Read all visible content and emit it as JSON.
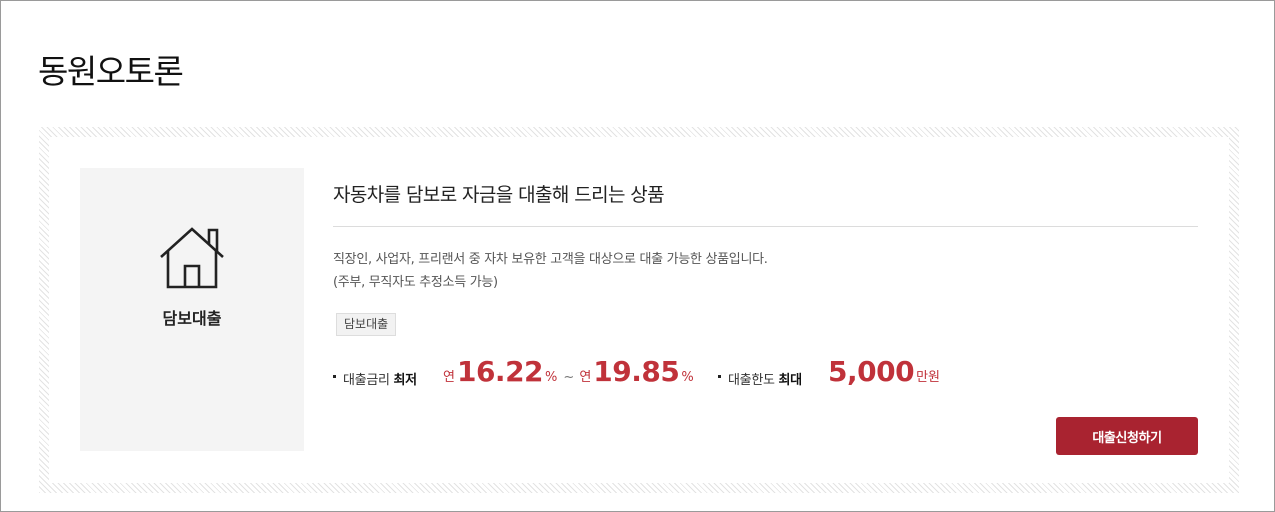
{
  "page": {
    "title": "동원오토론"
  },
  "product": {
    "thumb_label": "담보대출",
    "thumb_icon": "house-icon",
    "headline": "자동차를 담보로 자금을 대출해 드리는 상품",
    "description_line1": "직장인, 사업자, 프리랜서 중 자차 보유한 고객을 대상으로 대출 가능한 상품입니다.",
    "description_line2": "(주부, 무직자도 추정소득 가능)",
    "tag": "담보대출",
    "rate": {
      "label_prefix": "대출금리",
      "label_strong": "최저",
      "min_prefix": "연",
      "min_value": "16.22",
      "min_unit": "%",
      "separator": "~",
      "max_prefix": "연",
      "max_value": "19.85",
      "max_unit": "%"
    },
    "limit": {
      "label_prefix": "대출한도",
      "label_strong": "최대",
      "value": "5,000",
      "unit": "만원"
    },
    "apply_button": "대출신청하기"
  },
  "colors": {
    "accent": "#c0323a",
    "button": "#a92330",
    "thumb_bg": "#f4f4f4"
  }
}
